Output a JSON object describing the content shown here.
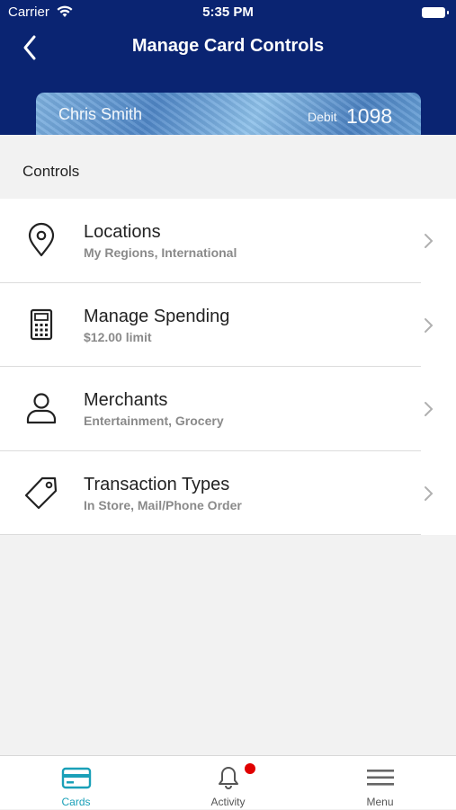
{
  "status_bar": {
    "carrier": "Carrier",
    "time": "5:35 PM"
  },
  "nav": {
    "title": "Manage Card Controls",
    "back_icon": "chevron-left-icon"
  },
  "card": {
    "holder": "Chris Smith",
    "type": "Debit",
    "last4": "1098"
  },
  "section": {
    "title": "Controls"
  },
  "controls": [
    {
      "title": "Locations",
      "subtitle": "My Regions, International",
      "icon": "location-pin-icon"
    },
    {
      "title": "Manage Spending",
      "subtitle": "$12.00 limit",
      "icon": "calculator-icon"
    },
    {
      "title": "Merchants",
      "subtitle": "Entertainment, Grocery",
      "icon": "person-icon"
    },
    {
      "title": "Transaction Types",
      "subtitle": "In Store, Mail/Phone Order",
      "icon": "tag-icon"
    }
  ],
  "tabbar": {
    "tabs": [
      {
        "label": "Cards",
        "icon": "card-icon",
        "active": true
      },
      {
        "label": "Activity",
        "icon": "bell-icon",
        "badge": true
      },
      {
        "label": "Menu",
        "icon": "menu-icon"
      }
    ]
  },
  "colors": {
    "header_bg": "#0a2472",
    "accent": "#1aa0b8",
    "badge": "#e00000"
  }
}
